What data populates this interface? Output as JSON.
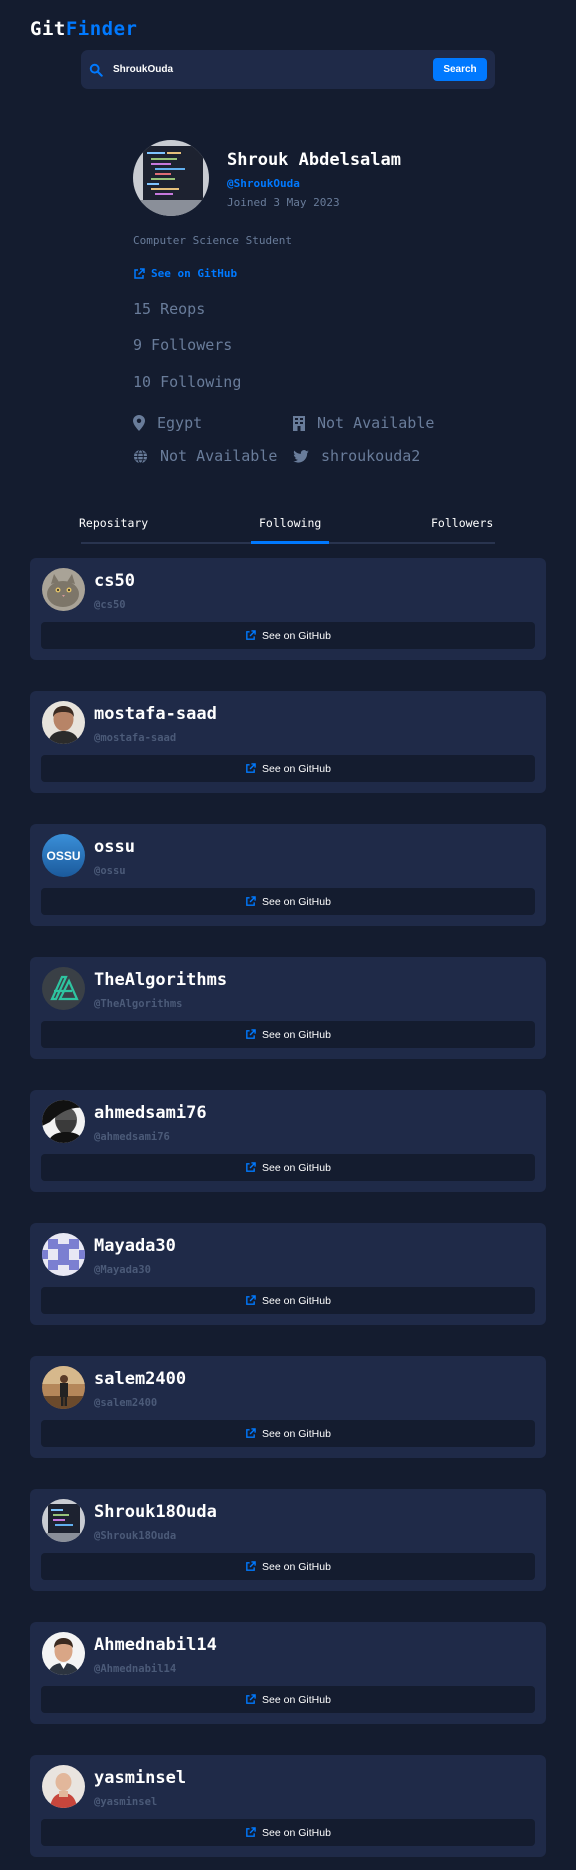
{
  "logo": {
    "part1": "Git",
    "part2": "Finder"
  },
  "search": {
    "value": "ShroukOuda",
    "button_label": "Search"
  },
  "profile": {
    "name": "Shrouk Abdelsalam",
    "login": "@ShroukOuda",
    "joined": "Joined 3 May 2023",
    "bio": "Computer Science Student",
    "github_link": "See on GitHub",
    "repos": "15 Reops",
    "followers": "9 Followers",
    "following": "10 Following",
    "location": "Egypt",
    "company": "Not Available",
    "website": "Not Available",
    "twitter": "shroukouda2"
  },
  "tabs": [
    {
      "label": "Repositary",
      "active": false
    },
    {
      "label": "Following",
      "active": true
    },
    {
      "label": "Followers",
      "active": false
    }
  ],
  "following_list": [
    {
      "name": "cs50",
      "login": "@cs50",
      "link": "See on GitHub"
    },
    {
      "name": "mostafa-saad",
      "login": "@mostafa-saad",
      "link": "See on GitHub"
    },
    {
      "name": "ossu",
      "login": "@ossu",
      "link": "See on GitHub",
      "avatar_text": "OSSU"
    },
    {
      "name": "TheAlgorithms",
      "login": "@TheAlgorithms",
      "link": "See on GitHub"
    },
    {
      "name": "ahmedsami76",
      "login": "@ahmedsami76",
      "link": "See on GitHub"
    },
    {
      "name": "Mayada30",
      "login": "@Mayada30",
      "link": "See on GitHub"
    },
    {
      "name": "salem2400",
      "login": "@salem2400",
      "link": "See on GitHub"
    },
    {
      "name": "Shrouk18Ouda",
      "login": "@Shrouk18Ouda",
      "link": "See on GitHub"
    },
    {
      "name": "Ahmednabil14",
      "login": "@Ahmednabil14",
      "link": "See on GitHub"
    },
    {
      "name": "yasminsel",
      "login": "@yasminsel",
      "link": "See on GitHub"
    }
  ],
  "colors": {
    "background": "#141c2f",
    "card": "#1f2a48",
    "accent": "#0079ff",
    "muted": "#697c9a"
  }
}
